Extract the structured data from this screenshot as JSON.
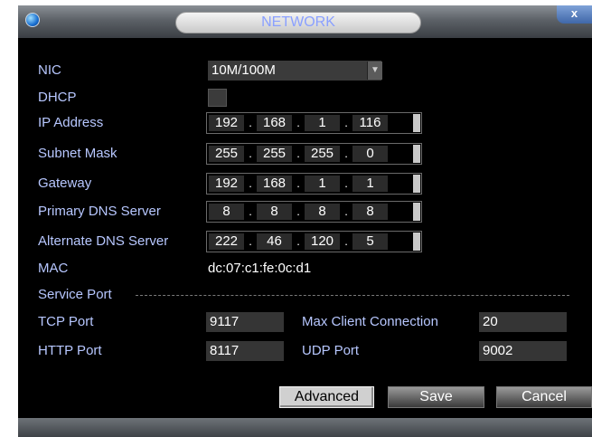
{
  "window": {
    "title": "NETWORK",
    "close_label": "x"
  },
  "fields": {
    "nic": {
      "label": "NIC",
      "value": "10M/100M"
    },
    "dhcp": {
      "label": "DHCP",
      "checked": false
    },
    "ip": {
      "label": "IP Address",
      "octets": [
        "192",
        "168",
        "1",
        "116"
      ]
    },
    "subnet": {
      "label": "Subnet Mask",
      "octets": [
        "255",
        "255",
        "255",
        "0"
      ]
    },
    "gateway": {
      "label": "Gateway",
      "octets": [
        "192",
        "168",
        "1",
        "1"
      ]
    },
    "dns1": {
      "label": "Primary DNS Server",
      "octets": [
        "8",
        "8",
        "8",
        "8"
      ]
    },
    "dns2": {
      "label": "Alternate DNS Server",
      "octets": [
        "222",
        "46",
        "120",
        "5"
      ]
    },
    "mac": {
      "label": "MAC",
      "value": "dc:07:c1:fe:0c:d1"
    }
  },
  "service": {
    "heading": "Service Port",
    "tcp": {
      "label": "TCP Port",
      "value": "9117"
    },
    "http": {
      "label": "HTTP Port",
      "value": "8117"
    },
    "max_client": {
      "label": "Max Client Connection",
      "value": "20"
    },
    "udp": {
      "label": "UDP Port",
      "value": "9002"
    }
  },
  "buttons": {
    "advanced": "Advanced",
    "save": "Save",
    "cancel": "Cancel"
  },
  "colors": {
    "label": "#b7c7ff",
    "value": "#ffffff",
    "background": "#000000",
    "title_text": "#8aa0ff"
  }
}
